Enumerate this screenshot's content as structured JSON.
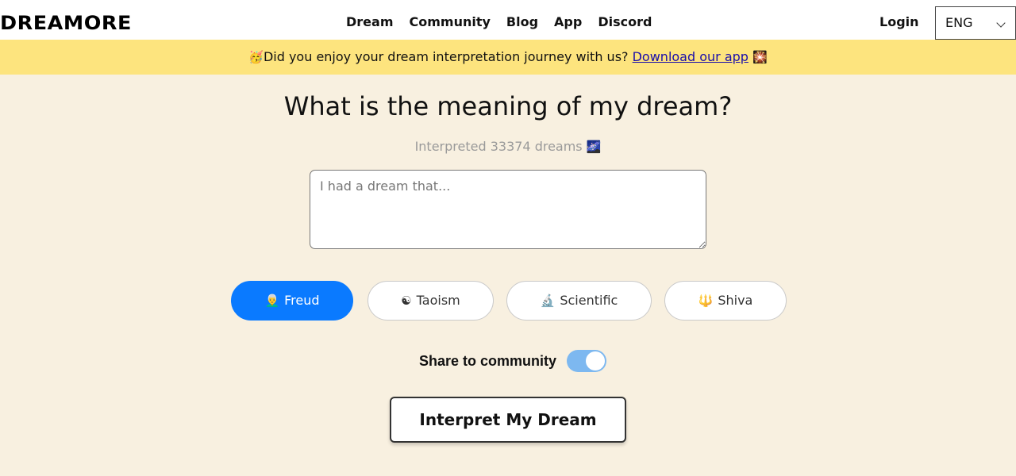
{
  "header": {
    "logo": "DREAMORE",
    "nav": [
      "Dream",
      "Community",
      "Blog",
      "App",
      "Discord"
    ],
    "login_label": "Login",
    "language": {
      "selected": "ENG"
    }
  },
  "banner": {
    "emoji_start": "🥳",
    "text": "Did you enjoy your dream interpretation journey with us?",
    "link_text": "Download our app",
    "emoji_end": "🎇"
  },
  "main": {
    "title": "What is the meaning of my dream?",
    "subtitle": "Interpreted 33374 dreams",
    "subtitle_emoji": "🌌",
    "dream_placeholder": "I had a dream that...",
    "dream_value": "",
    "styles": [
      {
        "label": "Freud",
        "icon": "👨‍🦳",
        "icon_name": "freud-icon",
        "selected": true
      },
      {
        "label": "Taoism",
        "icon": "☯",
        "icon_name": "yin-yang-icon",
        "selected": false
      },
      {
        "label": "Scientific",
        "icon": "🔬",
        "icon_name": "microscope-icon",
        "selected": false
      },
      {
        "label": "Shiva",
        "icon": "🔱",
        "icon_name": "trident-icon",
        "selected": false
      }
    ],
    "share_label": "Share to community",
    "share_enabled": true,
    "interpret_label": "Interpret My Dream"
  },
  "colors": {
    "background": "#f8f0e0",
    "banner": "#fde47e",
    "accent": "#0a7aff",
    "toggle_on": "#7db8f0"
  }
}
